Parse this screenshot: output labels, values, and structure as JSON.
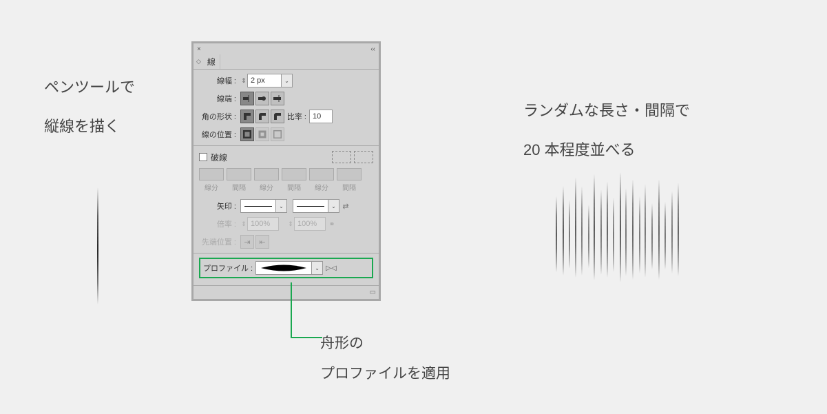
{
  "left_text": {
    "line1": "ペンツールで",
    "line2": "縦線を描く"
  },
  "right_text": {
    "line1": "ランダムな長さ・間隔で",
    "line2": "20 本程度並べる"
  },
  "callout": {
    "line1": "舟形の",
    "line2": "プロファイルを適用"
  },
  "panel": {
    "close": "×",
    "collapse": "‹‹",
    "tab": "線",
    "weight_label": "線幅 :",
    "weight_value": "2 px",
    "cap_label": "線端 :",
    "corner_label": "角の形状 :",
    "limit_label": "比率 :",
    "limit_value": "10",
    "align_label": "線の位置 :",
    "dashed_label": "破線",
    "dash_labels": [
      "線分",
      "間隔",
      "線分",
      "間隔",
      "線分",
      "間隔"
    ],
    "arrow_label": "矢印 :",
    "scale_label": "倍率 :",
    "scale_value": "100%",
    "tip_align_label": "先端位置 :",
    "profile_label": "プロファイル :"
  }
}
